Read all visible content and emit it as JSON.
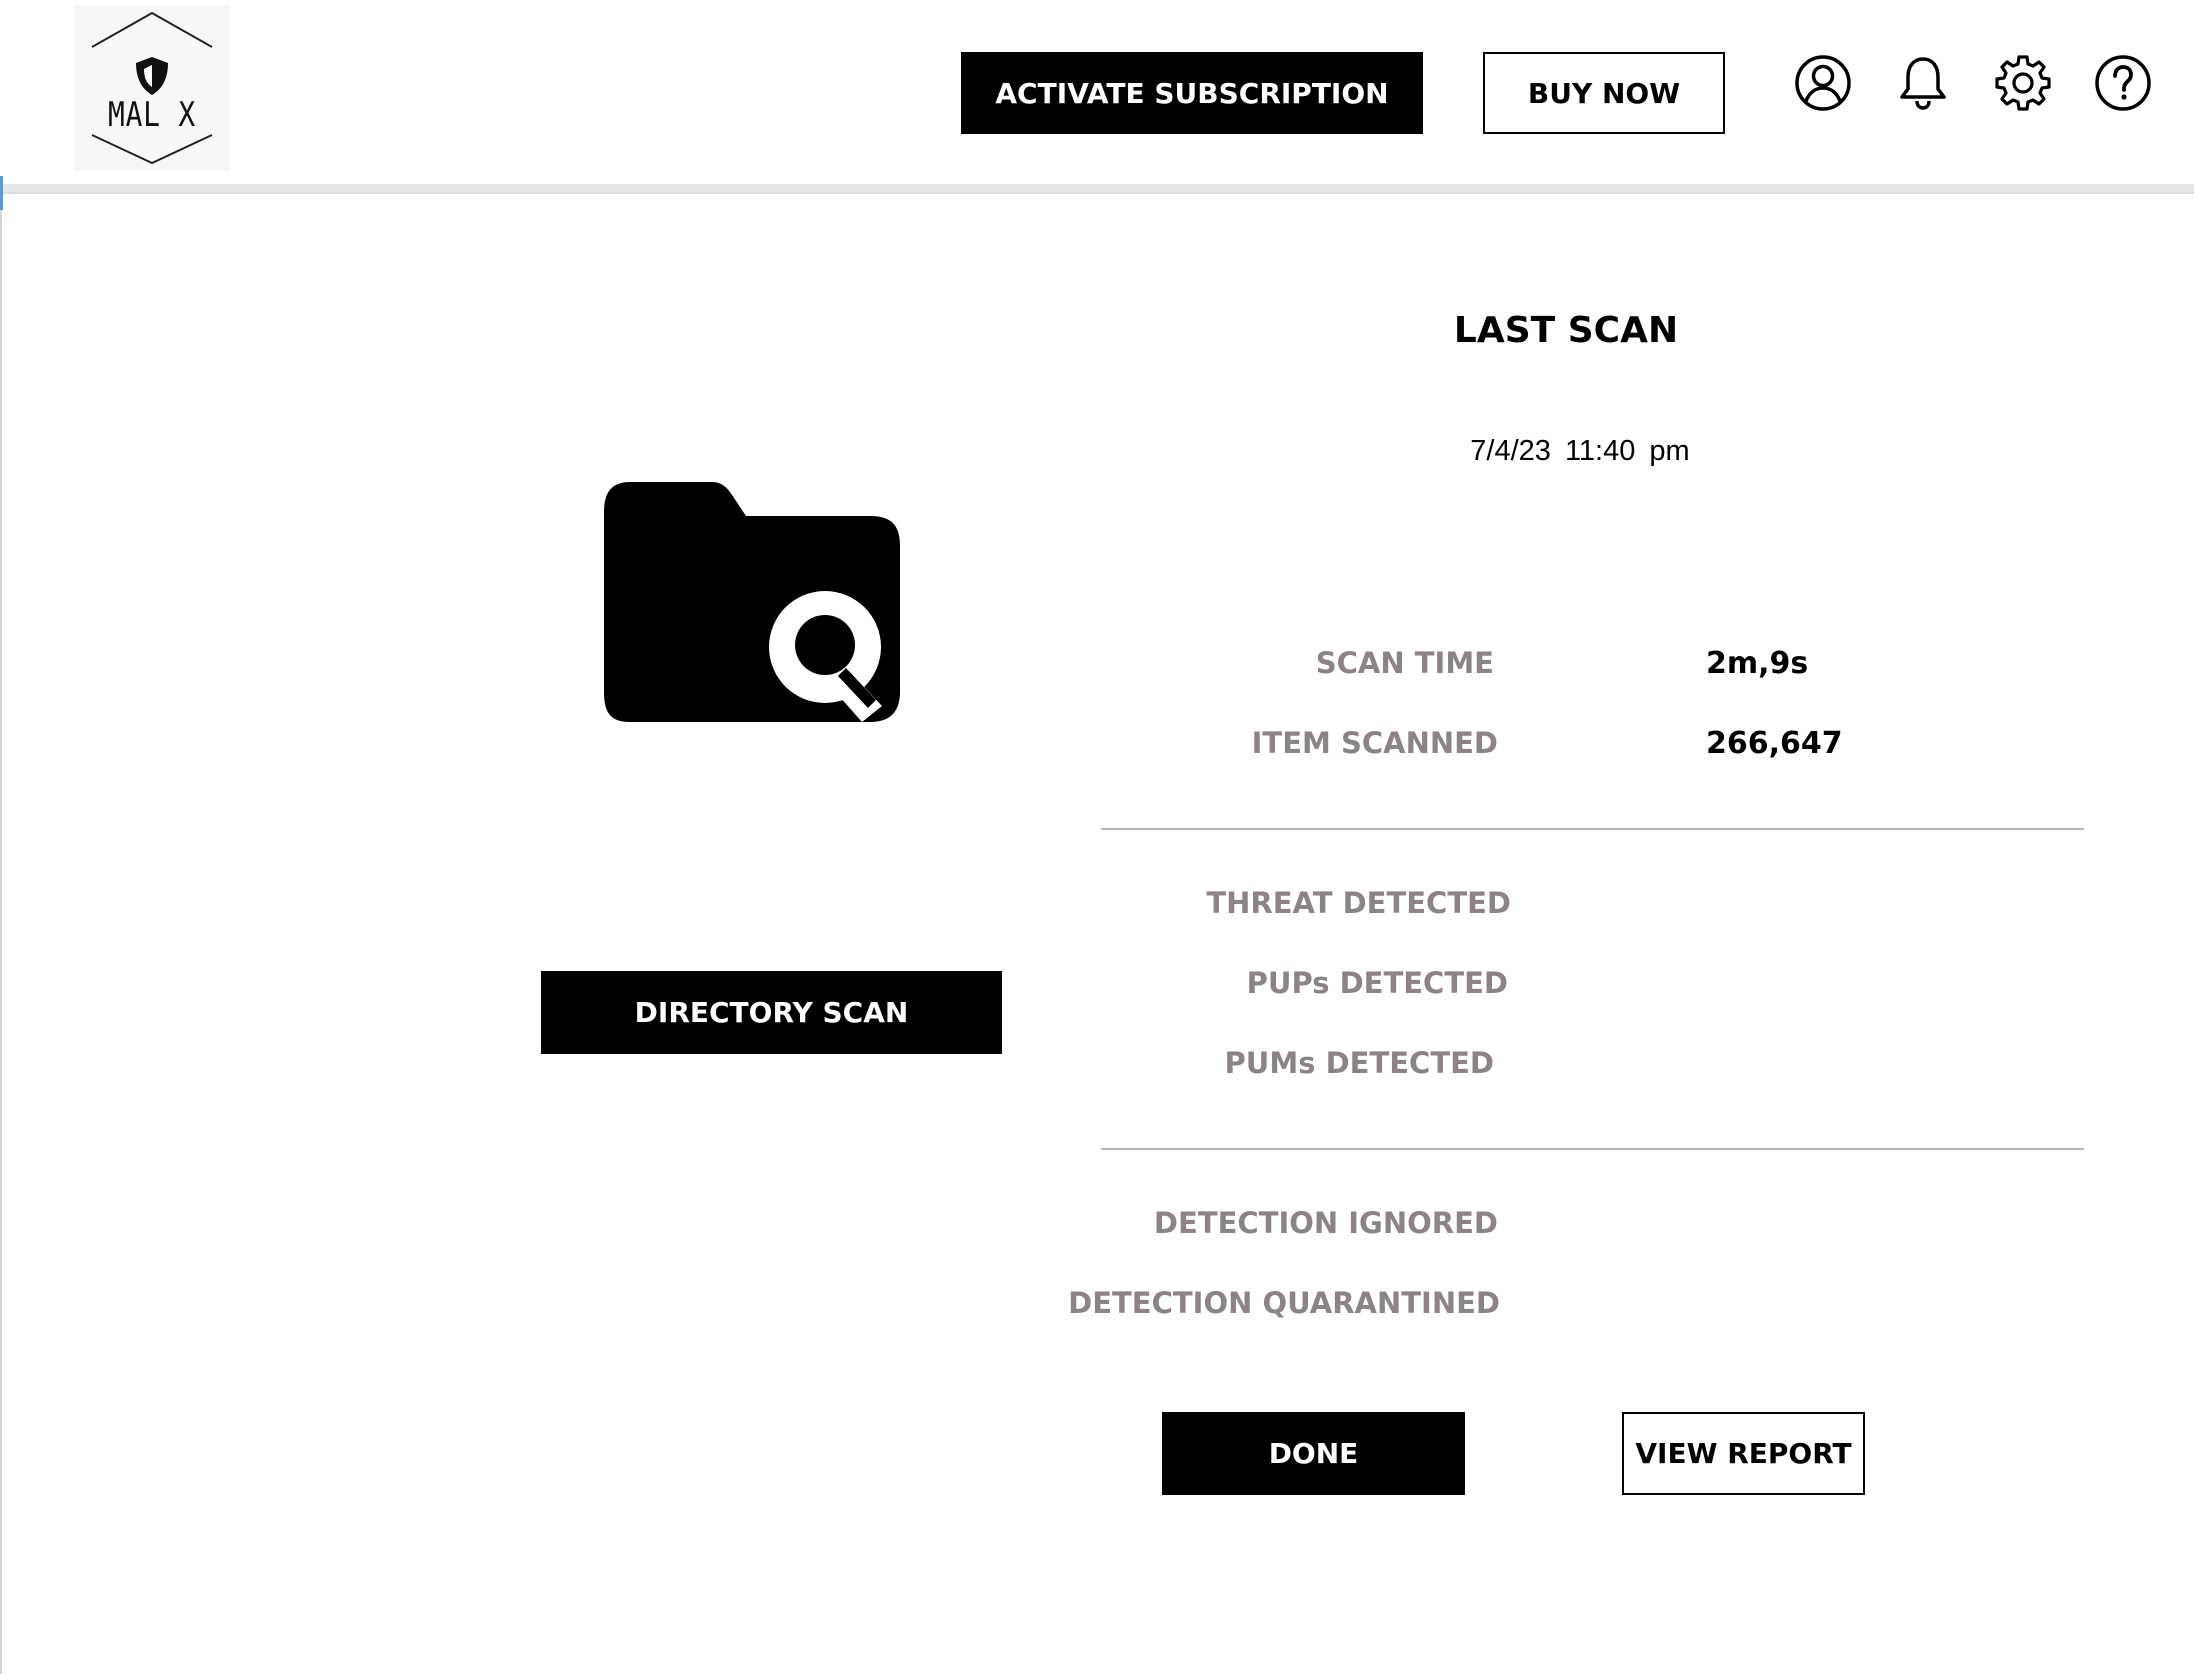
{
  "header": {
    "logo_text": "MAL X",
    "activate_label": "ACTIVATE SUBSCRIPTION",
    "buy_label": "BUY NOW",
    "icons": [
      "user-icon",
      "bell-icon",
      "gear-icon",
      "help-icon"
    ]
  },
  "left": {
    "folder_icon": "folder-search-icon",
    "directory_scan_label": "DIRECTORY SCAN"
  },
  "last_scan": {
    "title": "LAST SCAN",
    "datetime": "7/4/23  11:40 pm",
    "scan_time_label": "SCAN TIME",
    "scan_time_value": "2m,9s",
    "item_scanned_label": "ITEM SCANNED",
    "item_scanned_value": "266,647",
    "threat_label": "THREAT DETECTED",
    "pups_label": "PUPs DETECTED",
    "pums_label": "PUMs DETECTED",
    "ignored_label": "DETECTION IGNORED",
    "quarantined_label": "DETECTION QUARANTINED"
  },
  "actions": {
    "done_label": "DONE",
    "view_report_label": "VIEW REPORT"
  },
  "colors": {
    "primary": "#000000",
    "label_gray": "#8d8385",
    "divider": "#b5b5b5"
  }
}
